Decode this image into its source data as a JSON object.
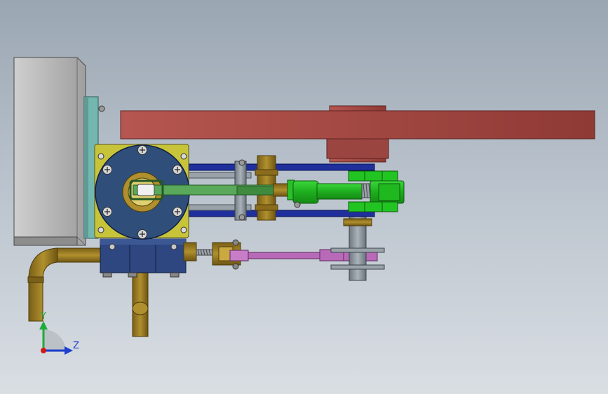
{
  "triad": {
    "y_label": "Y",
    "z_label": "Z",
    "colors": {
      "y": "#1faa3c",
      "z": "#1e3fd0",
      "x": "#d01818"
    }
  },
  "colors": {
    "gearbox": "#bfbfbf",
    "flywheel": "#a54a45",
    "cylinder_flange": "#c8c43a",
    "cylinder_cover": "#2f4f7a",
    "piston_rod": "#5aa85a",
    "crosshead": "#22c422",
    "brass": "#9a7a22",
    "valve_block": "#2e4780",
    "eccentric_rod": "#b86ab8",
    "steel": "#8e979f",
    "plate": "#74b7b0",
    "frame_rail": "#1f2f9c"
  }
}
